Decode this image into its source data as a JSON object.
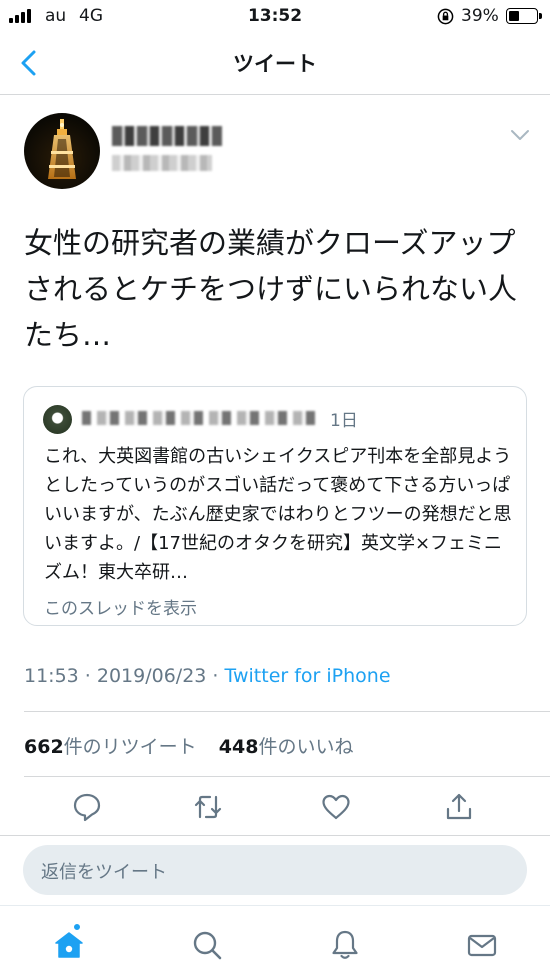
{
  "status_bar": {
    "carrier": "au",
    "network": "4G",
    "time": "13:52",
    "battery": "39%",
    "battery_level": 0.39
  },
  "nav": {
    "title": "ツイート",
    "back_icon": "chevron-left-icon"
  },
  "tweet": {
    "text": "女性の研究者の業績がクローズアップされるとケチをつけずにいられない人たち…",
    "timestamp": "11:53 · 2019/06/23 · ",
    "source": "Twitter for iPhone"
  },
  "quoted_tweet": {
    "time": "1日",
    "text": "これ、大英図書館の古いシェイクスピア刊本を全部見ようとしたっていうのがスゴい話だって褒めて下さる方いっぱいいますが、たぶん歴史家ではわりとフツーの発想だと思いますよ。/【17世紀のオタクを研究】英文学×フェミニズム！東大卒研…",
    "thread_link": "このスレッドを表示"
  },
  "stats": {
    "retweet_count": "662",
    "retweet_label": "件のリツイート",
    "like_count": "448",
    "like_label": "件のいいね"
  },
  "reply": {
    "placeholder": "返信をツイート"
  },
  "colors": {
    "accent": "#1da1f2",
    "secondary_text": "#657786",
    "divider": "#d6d8da",
    "reply_bg": "#e6ecf0"
  }
}
